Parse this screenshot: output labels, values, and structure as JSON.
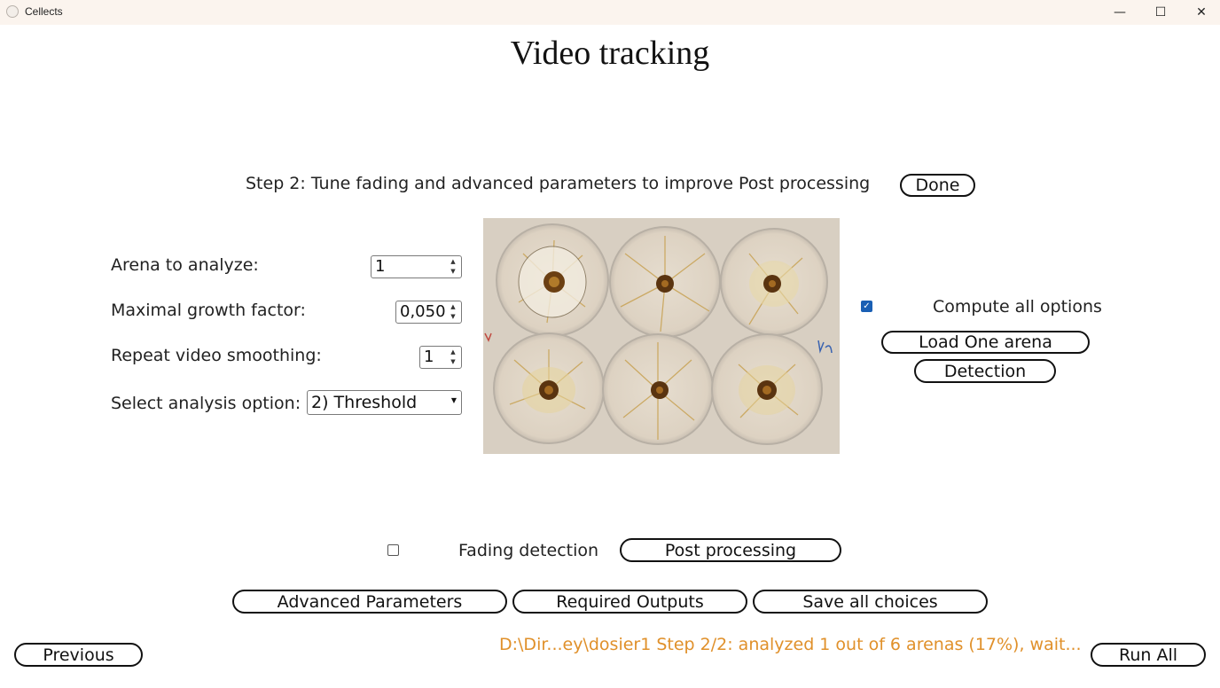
{
  "window": {
    "title": "Cellects",
    "controls": {
      "minimize": "—",
      "maximize": "☐",
      "close": "✕"
    }
  },
  "page": {
    "title": "Video tracking",
    "step_label": "Step 2: Tune fading and advanced parameters to improve Post processing",
    "done_button": "Done"
  },
  "params": {
    "arena_label": "Arena to analyze:",
    "arena_value": "1",
    "growth_label": "Maximal growth factor:",
    "growth_value": "0,050",
    "smoothing_label": "Repeat video smoothing:",
    "smoothing_value": "1",
    "option_label": "Select analysis option:",
    "option_value": "2) Threshold"
  },
  "right_panel": {
    "compute_all_label": "Compute all options",
    "compute_all_checked": true,
    "load_arena_button": "Load One arena",
    "detection_button": "Detection"
  },
  "fading": {
    "checkbox_checked": false,
    "label": "Fading detection",
    "post_processing_button": "Post processing"
  },
  "bottom_buttons": {
    "advanced": "Advanced Parameters",
    "outputs": "Required Outputs",
    "save": "Save all choices"
  },
  "footer": {
    "previous_button": "Previous",
    "status_text": "D:\\Dir...ey\\dosier1 Step 2/2: analyzed 1 out of 6 arenas (17%), wait...",
    "run_all_button": "Run All",
    "status_color": "#e0902a"
  },
  "icons": {
    "up_arrow": "▲",
    "down_arrow": "▼",
    "checkmark": "✓",
    "dropdown_caret": "▼"
  }
}
